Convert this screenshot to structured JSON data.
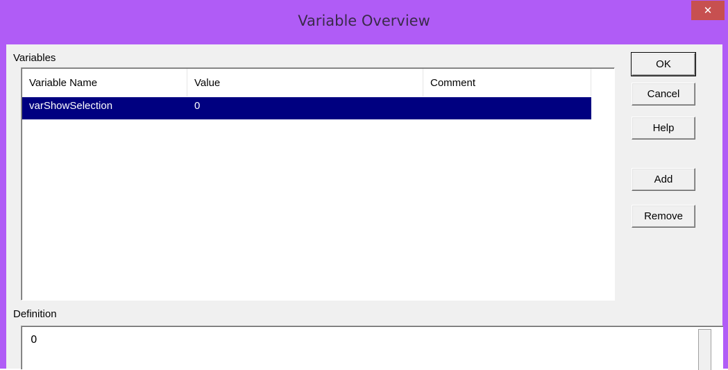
{
  "window": {
    "title": "Variable Overview",
    "close_glyph": "✕"
  },
  "variables": {
    "group_label": "Variables",
    "columns": [
      "Variable Name",
      "Value",
      "Comment"
    ],
    "rows": [
      {
        "name": "varShowSelection",
        "value": "0",
        "comment": ""
      }
    ]
  },
  "buttons": {
    "ok": "OK",
    "cancel": "Cancel",
    "help": "Help",
    "add": "Add",
    "remove": "Remove"
  },
  "definition": {
    "label": "Definition",
    "value": "0"
  },
  "colors": {
    "title_bar": "#b05cf6",
    "close_button": "#c75050",
    "selection": "#000080"
  },
  "icons": {
    "close": "close-icon"
  }
}
